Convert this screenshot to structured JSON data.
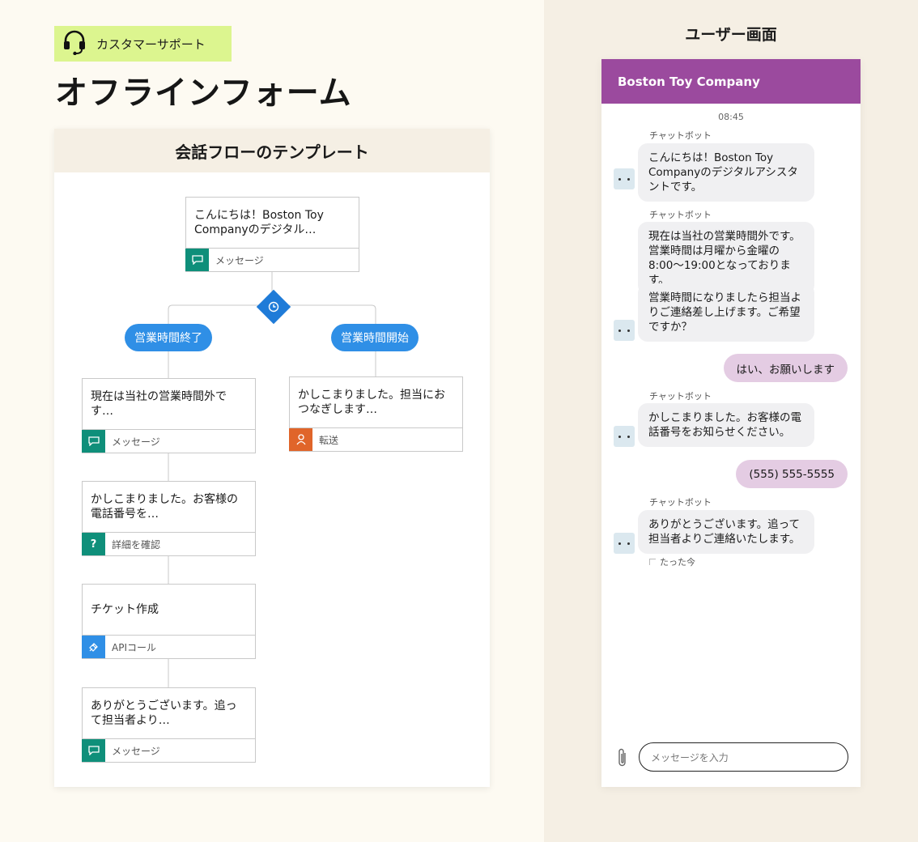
{
  "tag": {
    "label": "カスタマーサポート",
    "icon": "headset-icon"
  },
  "page_title": "オフラインフォーム",
  "flow": {
    "header": "会話フローのテンプレート",
    "nodes": {
      "greeting": {
        "text": "こんにちは！Boston Toy Companyのデジタル…",
        "type_label": "メッセージ",
        "icon": "message-icon"
      },
      "closed_msg": {
        "text": "現在は当社の営業時間外です…",
        "type_label": "メッセージ",
        "icon": "message-icon"
      },
      "confirm": {
        "text": "かしこまりました。お客様の電話番号を…",
        "type_label": "詳細を確認",
        "icon": "question-icon"
      },
      "ticket": {
        "text": "チケット作成",
        "type_label": "APIコール",
        "icon": "plug-icon"
      },
      "thanks": {
        "text": "ありがとうございます。追って担当者より…",
        "type_label": "メッセージ",
        "icon": "message-icon"
      },
      "transfer": {
        "text": "かしこまりました。担当におつなぎします…",
        "type_label": "転送",
        "icon": "person-icon"
      }
    },
    "branches": {
      "closed": "営業時間終了",
      "open": "営業時間開始"
    },
    "colors": {
      "message": "#0f8f7a",
      "transfer": "#e0652a",
      "api": "#2f8fe6",
      "branch": "#2f8fe6",
      "diamond": "#1f7bd8"
    }
  },
  "user_screen": {
    "title": "ユーザー画面",
    "company": "Boston Toy Company",
    "header_color": "#9b4a9e",
    "time": "08:45",
    "sender_name": "チャットボット",
    "messages": {
      "m1": "こんにちは！Boston Toy Companyのデジタルアシスタントです。",
      "m2": "現在は当社の営業時間外です。営業時間は月曜から金曜の8:00〜19:00となっております。",
      "m3": "営業時間になりましたら担当よりご連絡差し上げます。ご希望ですか？",
      "u1": "はい、お願いします",
      "m4": "かしこまりました。お客様の電話番号をお知らせください。",
      "u2": "(555) 555-5555",
      "m5": "ありがとうございます。追って担当者よりご連絡いたします。"
    },
    "status": "たった今",
    "composer_placeholder": "メッセージを入力",
    "attach_icon": "paperclip-icon"
  }
}
